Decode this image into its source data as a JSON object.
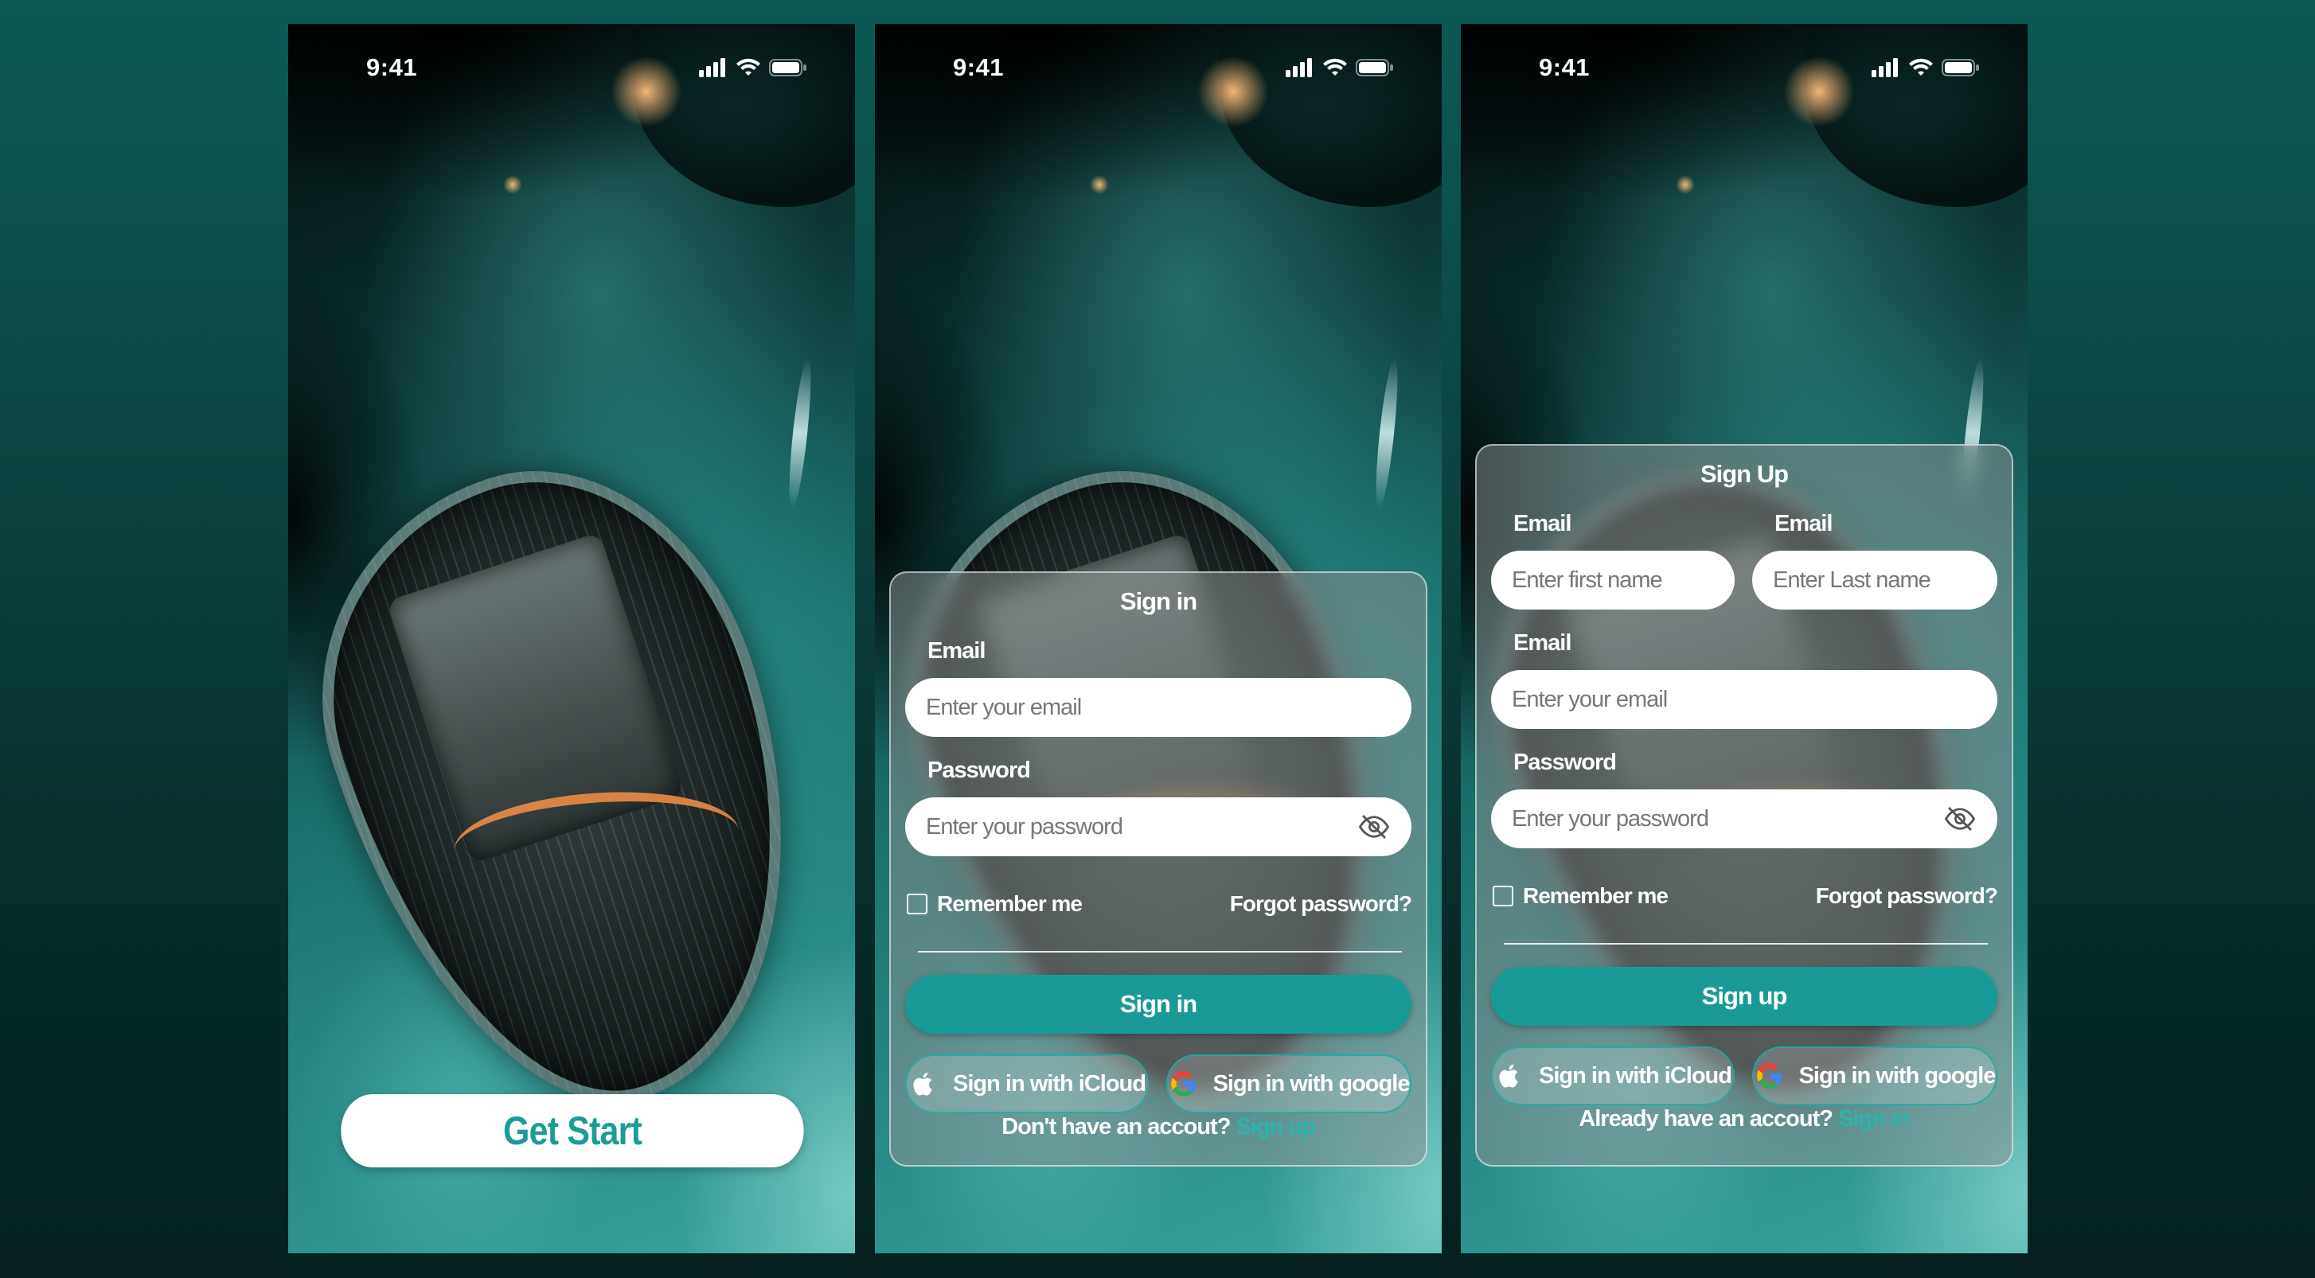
{
  "status_bar": {
    "time": "9:41"
  },
  "screen1": {
    "get_start_label": "Get Start"
  },
  "signin": {
    "title": "Sign in",
    "email_label": "Email",
    "email_placeholder": "Enter your email",
    "password_label": "Password",
    "password_placeholder": "Enter your password",
    "remember_label": "Remember me",
    "forgot_label": "Forgot password?",
    "submit_label": "Sign in",
    "icloud_label": "Sign in with iCloud",
    "google_label": "Sign in with google",
    "bottom_text": "Don't have an accout?",
    "bottom_link": "Sign up"
  },
  "signup": {
    "title": "Sign Up",
    "first_label": "Email",
    "first_placeholder": "Enter first name",
    "last_label": "Email",
    "last_placeholder": "Enter Last name",
    "email_label": "Email",
    "email_placeholder": "Enter your email",
    "password_label": "Password",
    "password_placeholder": "Enter your password",
    "remember_label": "Remember me",
    "forgot_label": "Forgot password?",
    "submit_label": "Sign up",
    "icloud_label": "Sign in with iCloud",
    "google_label": "Sign in with google",
    "bottom_text": "Already have an accout?",
    "bottom_link": "Sign in"
  },
  "colors": {
    "accent": "#1a9a96",
    "link": "#2cb3ad",
    "background": "#0a423e"
  },
  "icons": [
    "signal-icon",
    "wifi-icon",
    "battery-icon",
    "eye-off-icon",
    "apple-icon",
    "google-icon"
  ]
}
